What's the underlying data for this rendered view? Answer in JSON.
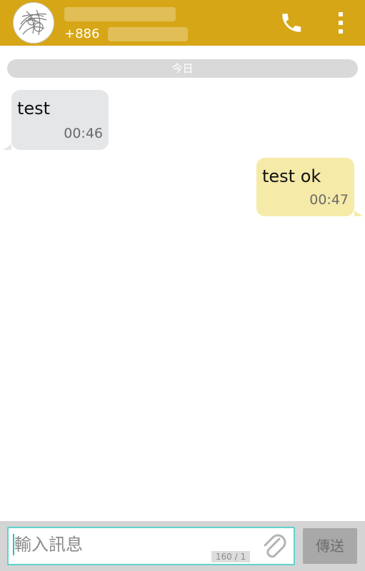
{
  "header": {
    "contact_number_prefix": "+886",
    "accent_color": "#d7a616",
    "call_icon": "phone-icon",
    "menu_icon": "more-vertical-icon"
  },
  "conversation": {
    "date_label": "今日",
    "messages": [
      {
        "direction": "incoming",
        "text": "test",
        "time": "00:46"
      },
      {
        "direction": "outgoing",
        "text": "test ok",
        "time": "00:47"
      }
    ]
  },
  "composer": {
    "placeholder": "輸入訊息",
    "counter": "160 / 1",
    "attach_icon": "paperclip-icon",
    "send_label": "傳送"
  }
}
